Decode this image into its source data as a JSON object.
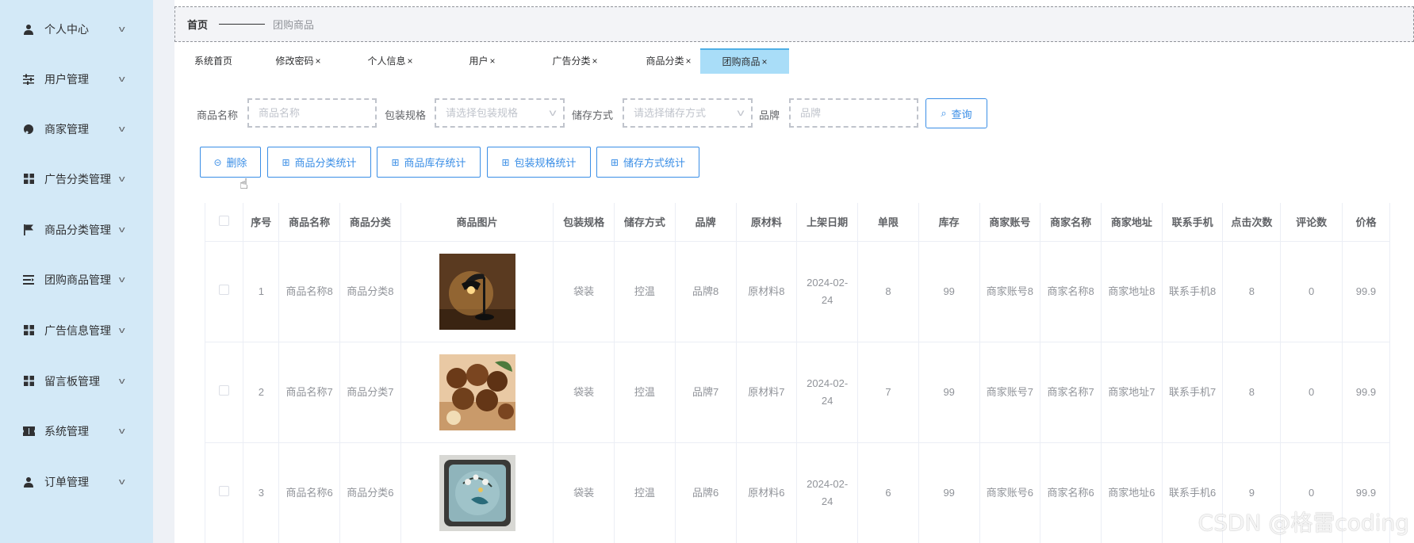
{
  "sidebar": {
    "items": [
      {
        "label": "个人中心",
        "icon": "user-icon"
      },
      {
        "label": "用户管理",
        "icon": "sliders-icon"
      },
      {
        "label": "商家管理",
        "icon": "palette-icon"
      },
      {
        "label": "广告分类管理",
        "icon": "grid-icon"
      },
      {
        "label": "商品分类管理",
        "icon": "flag-icon"
      },
      {
        "label": "团购商品管理",
        "icon": "list-icon"
      },
      {
        "label": "广告信息管理",
        "icon": "grid-icon"
      },
      {
        "label": "留言板管理",
        "icon": "grid-icon"
      },
      {
        "label": "系统管理",
        "icon": "ticket-icon"
      },
      {
        "label": "订单管理",
        "icon": "user-icon"
      }
    ]
  },
  "breadcrumb": {
    "home": "首页",
    "current": "团购商品"
  },
  "tabs": [
    {
      "label": "系统首页",
      "closable": false
    },
    {
      "label": "修改密码",
      "closable": true
    },
    {
      "label": "个人信息",
      "closable": true
    },
    {
      "label": "用户",
      "closable": true
    },
    {
      "label": "广告分类",
      "closable": true
    },
    {
      "label": "商品分类",
      "closable": true
    },
    {
      "label": "团购商品",
      "closable": true,
      "active": true
    }
  ],
  "tab_close_glyph": "×",
  "search": {
    "name_label": "商品名称",
    "name_placeholder": "商品名称",
    "spec_label": "包装规格",
    "spec_placeholder": "请选择包装规格",
    "storage_label": "储存方式",
    "storage_placeholder": "请选择储存方式",
    "brand_label": "品牌",
    "brand_placeholder": "品牌",
    "query_label": "查询"
  },
  "actions": {
    "delete": "删除",
    "category_stats": "商品分类统计",
    "stock_stats": "商品库存统计",
    "spec_stats": "包装规格统计",
    "storage_stats": "储存方式统计"
  },
  "table": {
    "headers": [
      "",
      "序号",
      "商品名称",
      "商品分类",
      "商品图片",
      "包装规格",
      "储存方式",
      "品牌",
      "原材料",
      "上架日期",
      "单限",
      "库存",
      "商家账号",
      "商家名称",
      "商家地址",
      "联系手机",
      "点击次数",
      "评论数",
      "价格"
    ],
    "rows": [
      {
        "idx": "1",
        "name": "商品名称8",
        "category": "商品分类8",
        "image": "lamp-photo",
        "spec": "袋装",
        "storage": "控温",
        "brand": "品牌8",
        "material": "原材料8",
        "date": "2024-02-24",
        "limit": "8",
        "stock": "99",
        "account": "商家账号8",
        "merchant": "商家名称8",
        "address": "商家地址8",
        "phone": "联系手机8",
        "clicks": "8",
        "comments": "0",
        "price": "99.9"
      },
      {
        "idx": "2",
        "name": "商品名称7",
        "category": "商品分类7",
        "image": "nuts-photo",
        "spec": "袋装",
        "storage": "控温",
        "brand": "品牌7",
        "material": "原材料7",
        "date": "2024-02-24",
        "limit": "7",
        "stock": "99",
        "account": "商家账号7",
        "merchant": "商家名称7",
        "address": "商家地址7",
        "phone": "联系手机7",
        "clicks": "8",
        "comments": "0",
        "price": "99.9"
      },
      {
        "idx": "3",
        "name": "商品名称6",
        "category": "商品分类6",
        "image": "pillow-photo",
        "spec": "袋装",
        "storage": "控温",
        "brand": "品牌6",
        "material": "原材料6",
        "date": "2024-02-24",
        "limit": "6",
        "stock": "99",
        "account": "商家账号6",
        "merchant": "商家名称6",
        "address": "商家地址6",
        "phone": "联系手机6",
        "clicks": "9",
        "comments": "0",
        "price": "99.9"
      }
    ]
  },
  "watermark": "CSDN @格雷coding",
  "colors": {
    "sidebar_bg": "#d3e9f7",
    "accent": "#3a8ee6",
    "active_tab_bg": "#a9ddf8"
  }
}
